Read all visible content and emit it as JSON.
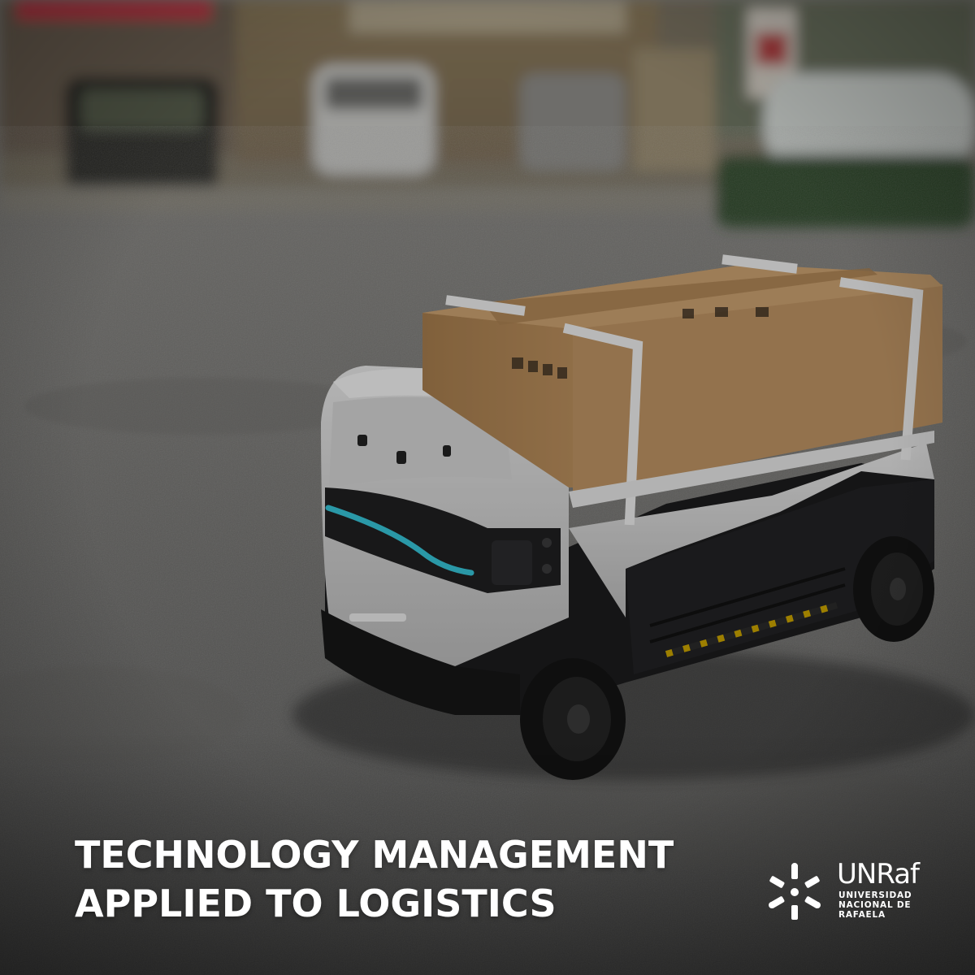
{
  "poster": {
    "headline_line1": "TECHNOLOGY MANAGEMENT",
    "headline_line2": "APPLIED TO LOGISTICS"
  },
  "logo": {
    "name": "UNRaf",
    "sub_line1": "UNIVERSIDAD",
    "sub_line2": "NACIONAL DE",
    "sub_line3": "RAFAELA"
  },
  "colors": {
    "overlay": "#000000",
    "robot_accent": "#36c3d6",
    "box": "#b88d5c",
    "text": "#ffffff"
  }
}
